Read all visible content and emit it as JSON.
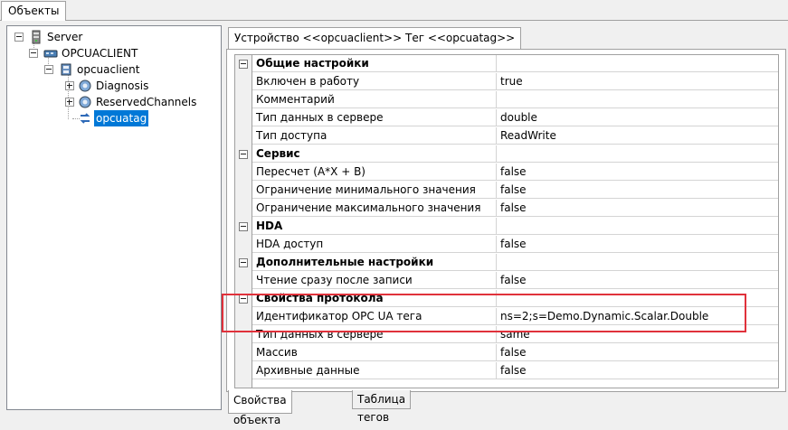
{
  "top_tab": "Объекты",
  "tree": [
    {
      "label": "Server",
      "icon": "server-icon"
    },
    {
      "label": "OPCUACLIENT",
      "icon": "network-driver-icon"
    },
    {
      "label": "opcuaclient",
      "icon": "device-icon"
    },
    {
      "label": "Diagnosis",
      "icon": "tag-group-icon"
    },
    {
      "label": "ReservedChannels",
      "icon": "tag-group-icon"
    },
    {
      "label": "opcuatag",
      "icon": "tag-icon",
      "selected": true
    }
  ],
  "panel_tab": "Устройство <<opcuaclient>> Тег <<opcuatag>>",
  "properties": [
    {
      "type": "category",
      "name": "Общие настройки"
    },
    {
      "name": "Включен в работу",
      "value": "true"
    },
    {
      "name": "Комментарий",
      "value": ""
    },
    {
      "name": "Тип данных в сервере",
      "value": "double"
    },
    {
      "name": "Тип доступа",
      "value": "ReadWrite"
    },
    {
      "type": "category",
      "name": "Сервис"
    },
    {
      "name": "Пересчет (A*X + B)",
      "value": "false"
    },
    {
      "name": "Ограничение минимального значения",
      "value": "false"
    },
    {
      "name": "Ограничение максимального значения",
      "value": "false"
    },
    {
      "type": "category",
      "name": "HDA"
    },
    {
      "name": "HDA доступ",
      "value": "false"
    },
    {
      "type": "category",
      "name": "Дополнительные настройки"
    },
    {
      "name": "Чтение сразу после записи",
      "value": "false"
    },
    {
      "type": "category",
      "name": "Свойства протокола"
    },
    {
      "name": "Идентификатор OPC UA тега",
      "value": "ns=2;s=Demo.Dynamic.Scalar.Double"
    },
    {
      "name": "Тип данных в сервере",
      "value": "same"
    },
    {
      "name": "Массив",
      "value": "false"
    },
    {
      "name": "Архивные данные",
      "value": "false"
    }
  ],
  "bottom_tabs": [
    "Свойства объекта",
    "Таблица тегов"
  ],
  "colors": {
    "selection": "#0078d7",
    "highlight_box": "#e0313b"
  }
}
